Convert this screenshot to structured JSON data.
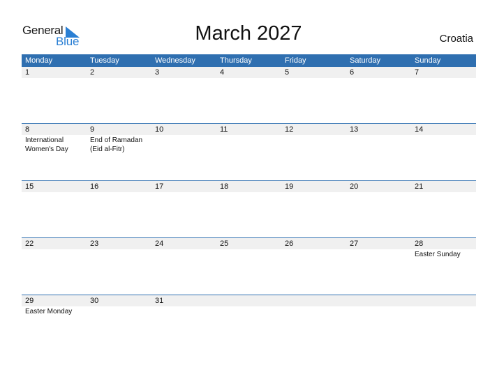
{
  "logo": {
    "line1": "General",
    "line2": "Blue",
    "accent_color": "#2a7fd4"
  },
  "title": "March 2027",
  "country": "Croatia",
  "colors": {
    "header_bg": "#2f6fb0",
    "band_bg": "#f0f0f0"
  },
  "weekdays": [
    "Monday",
    "Tuesday",
    "Wednesday",
    "Thursday",
    "Friday",
    "Saturday",
    "Sunday"
  ],
  "weeks": [
    [
      {
        "day": "1",
        "event": ""
      },
      {
        "day": "2",
        "event": ""
      },
      {
        "day": "3",
        "event": ""
      },
      {
        "day": "4",
        "event": ""
      },
      {
        "day": "5",
        "event": ""
      },
      {
        "day": "6",
        "event": ""
      },
      {
        "day": "7",
        "event": ""
      }
    ],
    [
      {
        "day": "8",
        "event": "International Women's Day"
      },
      {
        "day": "9",
        "event": "End of Ramadan (Eid al-Fitr)"
      },
      {
        "day": "10",
        "event": ""
      },
      {
        "day": "11",
        "event": ""
      },
      {
        "day": "12",
        "event": ""
      },
      {
        "day": "13",
        "event": ""
      },
      {
        "day": "14",
        "event": ""
      }
    ],
    [
      {
        "day": "15",
        "event": ""
      },
      {
        "day": "16",
        "event": ""
      },
      {
        "day": "17",
        "event": ""
      },
      {
        "day": "18",
        "event": ""
      },
      {
        "day": "19",
        "event": ""
      },
      {
        "day": "20",
        "event": ""
      },
      {
        "day": "21",
        "event": ""
      }
    ],
    [
      {
        "day": "22",
        "event": ""
      },
      {
        "day": "23",
        "event": ""
      },
      {
        "day": "24",
        "event": ""
      },
      {
        "day": "25",
        "event": ""
      },
      {
        "day": "26",
        "event": ""
      },
      {
        "day": "27",
        "event": ""
      },
      {
        "day": "28",
        "event": "Easter Sunday"
      }
    ],
    [
      {
        "day": "29",
        "event": "Easter Monday"
      },
      {
        "day": "30",
        "event": ""
      },
      {
        "day": "31",
        "event": ""
      },
      {
        "day": "",
        "event": ""
      },
      {
        "day": "",
        "event": ""
      },
      {
        "day": "",
        "event": ""
      },
      {
        "day": "",
        "event": ""
      }
    ]
  ]
}
